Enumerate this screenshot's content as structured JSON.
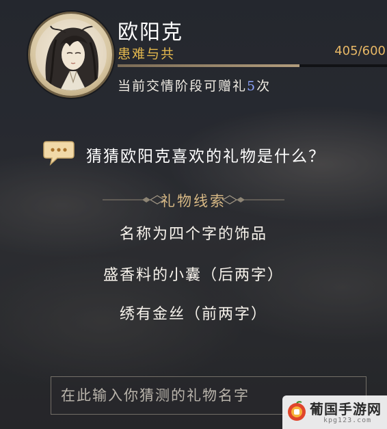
{
  "character": {
    "name": "欧阳克",
    "relation_stage": "患难与共",
    "affection_text": "405/600",
    "affection_current": 405,
    "affection_max": 600,
    "gift_line_prefix": "当前交情阶段可赠礼",
    "gift_count": "5",
    "gift_line_suffix": "次"
  },
  "question": {
    "text": "猜猜欧阳克喜欢的礼物是什么？",
    "icon": "speech-bubble-icon"
  },
  "clues": {
    "title": "礼物线索",
    "items": [
      "名称为四个字的饰品",
      "盛香料的小囊（后两字）",
      "绣有金丝（前两字）"
    ]
  },
  "answer_input": {
    "placeholder": "在此输入你猜测的礼物名字",
    "value": ""
  },
  "watermark": {
    "text": "葡国手游网",
    "subtext": "kpg123.com"
  },
  "colors": {
    "relation": "#e4b84e",
    "affection_value": "#e8b866",
    "gift_count": "#8fa7ff",
    "clue_title": "#d8b985"
  }
}
